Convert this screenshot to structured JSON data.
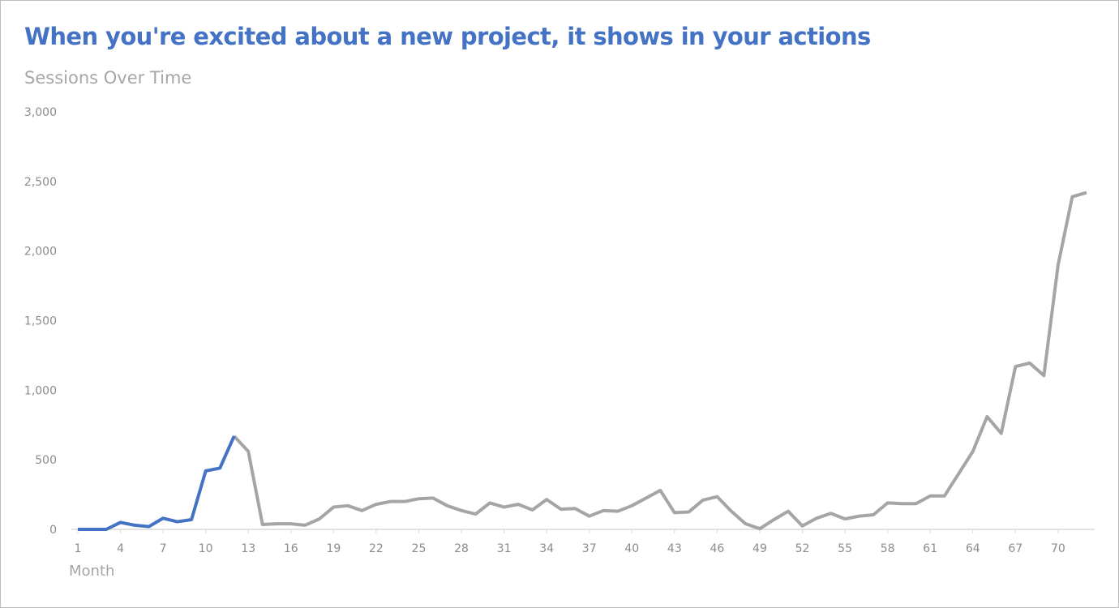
{
  "chart_data": {
    "type": "line",
    "title": "When you're excited about a new project, it shows in your actions",
    "subtitle": "Sessions Over Time",
    "xlabel": "Month",
    "ylabel": "",
    "ylim": [
      0,
      3000
    ],
    "yticks": [
      0,
      500,
      1000,
      1500,
      2000,
      2500,
      3000
    ],
    "ytick_labels": [
      "0",
      "500",
      "1,000",
      "1,500",
      "2,000",
      "2,500",
      "3,000"
    ],
    "xtick_labels": [
      "1",
      "4",
      "7",
      "10",
      "13",
      "16",
      "19",
      "22",
      "25",
      "28",
      "31",
      "34",
      "37",
      "40",
      "43",
      "46",
      "49",
      "52",
      "55",
      "58",
      "61",
      "64",
      "67",
      "70"
    ],
    "grid": false,
    "highlight_months": [
      1,
      12
    ],
    "colors": {
      "highlight": "#4472c4",
      "base": "#a5a5a5",
      "title": "#4472c4",
      "subtitle": "#a6a6a6"
    },
    "x": [
      1,
      2,
      3,
      4,
      5,
      6,
      7,
      8,
      9,
      10,
      11,
      12,
      13,
      14,
      15,
      16,
      17,
      18,
      19,
      20,
      21,
      22,
      23,
      24,
      25,
      26,
      27,
      28,
      29,
      30,
      31,
      32,
      33,
      34,
      35,
      36,
      37,
      38,
      39,
      40,
      41,
      42,
      43,
      44,
      45,
      46,
      47,
      48,
      49,
      50,
      51,
      52,
      53,
      54,
      55,
      56,
      57,
      58,
      59,
      60,
      61,
      62,
      63,
      64,
      65,
      66,
      67,
      68,
      69,
      70,
      71,
      72
    ],
    "values": [
      0,
      0,
      0,
      50,
      30,
      20,
      80,
      55,
      70,
      420,
      440,
      670,
      560,
      35,
      40,
      40,
      30,
      75,
      160,
      170,
      135,
      180,
      200,
      200,
      220,
      225,
      170,
      135,
      110,
      190,
      160,
      180,
      140,
      215,
      145,
      150,
      95,
      135,
      130,
      170,
      225,
      280,
      120,
      125,
      210,
      235,
      130,
      40,
      5,
      70,
      130,
      25,
      80,
      115,
      75,
      95,
      105,
      190,
      185,
      185,
      240,
      240,
      400,
      560,
      810,
      690,
      1170,
      1195,
      1105,
      1900,
      2390,
      2420
    ]
  }
}
